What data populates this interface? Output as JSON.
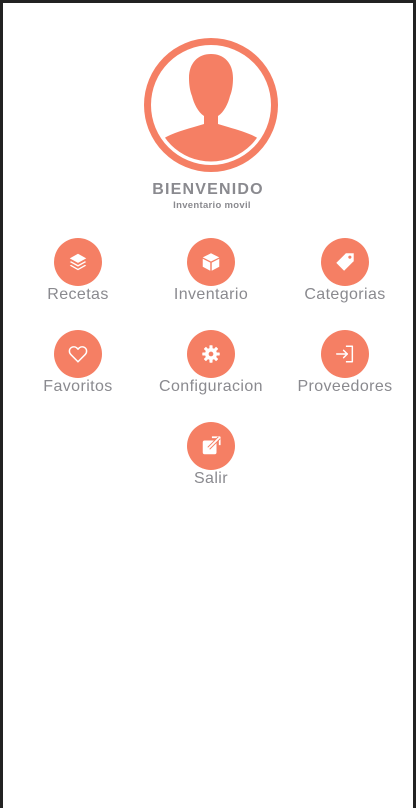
{
  "header": {
    "welcome": "BIENVENIDO",
    "subtitle": "Inventario movil"
  },
  "colors": {
    "accent": "#f57f64",
    "text": "#8a8a8f",
    "frame": "#222222"
  },
  "menu": {
    "items": [
      {
        "label": "Recetas",
        "icon": "layers-icon"
      },
      {
        "label": "Inventario",
        "icon": "box-icon"
      },
      {
        "label": "Categorias",
        "icon": "tag-icon"
      },
      {
        "label": "Favoritos",
        "icon": "heart-icon"
      },
      {
        "label": "Configuracion",
        "icon": "gear-icon"
      },
      {
        "label": "Proveedores",
        "icon": "login-icon"
      },
      {
        "label": "Salir",
        "icon": "external-link-icon"
      }
    ]
  }
}
